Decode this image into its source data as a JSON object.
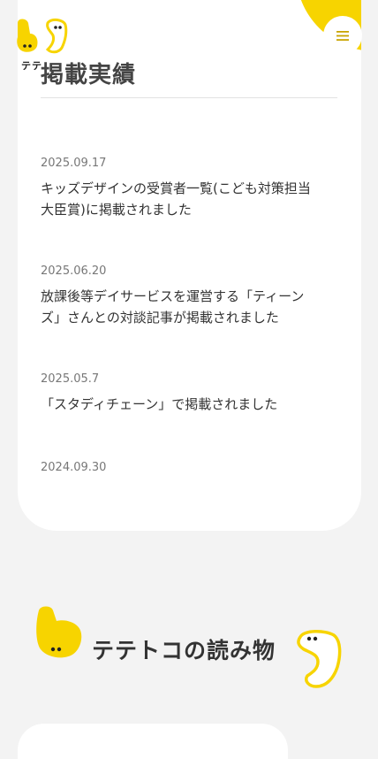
{
  "brand": {
    "logo_text": "テテ"
  },
  "header": {
    "menu_icon": "hamburger-icon"
  },
  "colors": {
    "accent": "#f7d400",
    "background": "#f3f3f3",
    "card": "#ffffff"
  },
  "press": {
    "heading": "掲載実績",
    "items": [
      {
        "date": "2025.09.17",
        "title": "キッズデザインの受賞者一覧(こども対策担当大臣賞)に掲載されました"
      },
      {
        "date": "2025.06.20",
        "title": "放課後等デイサービスを運営する「ティーンズ」さんとの対談記事が掲載されました"
      },
      {
        "date": "2025.05.7",
        "title": "「スタディチェーン」で掲載されました"
      },
      {
        "date": "2024.09.30",
        "title": ""
      }
    ]
  },
  "reading": {
    "heading": "テテトコの読み物"
  }
}
